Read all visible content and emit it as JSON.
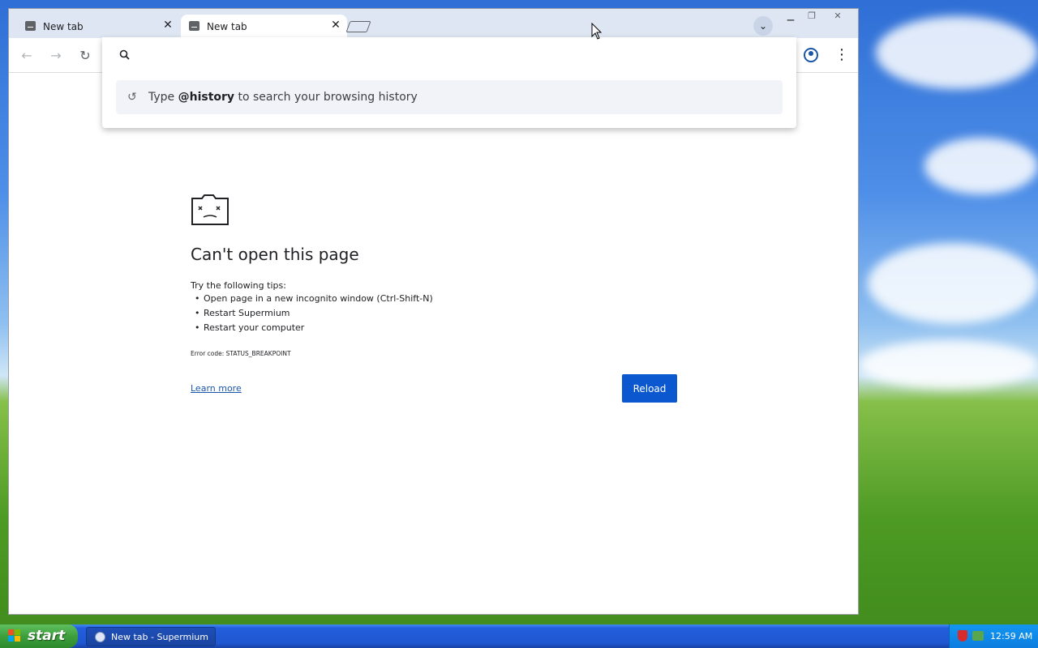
{
  "browser": {
    "tabs": [
      {
        "title": "New tab",
        "active": false
      },
      {
        "title": "New tab",
        "active": true
      }
    ]
  },
  "omnibox": {
    "value": "",
    "suggestion_prefix": "Type ",
    "suggestion_keyword": "@history",
    "suggestion_suffix": " to search your browsing history"
  },
  "error_page": {
    "title": "Can't open this page",
    "tips_heading": "Try the following tips:",
    "tips": [
      "Open page in a new incognito window (Ctrl-Shift-N)",
      "Restart Supermium",
      "Restart your computer"
    ],
    "error_code": "Error code: STATUS_BREAKPOINT",
    "learn_more": "Learn more",
    "reload": "Reload"
  },
  "taskbar": {
    "start": "start",
    "task_item": "New tab - Supermium",
    "clock": "12:59 AM"
  },
  "colors": {
    "accent": "#0b57d0",
    "link": "#1a56a8",
    "taskbar": "#245edb",
    "start": "#3c9f3c"
  }
}
